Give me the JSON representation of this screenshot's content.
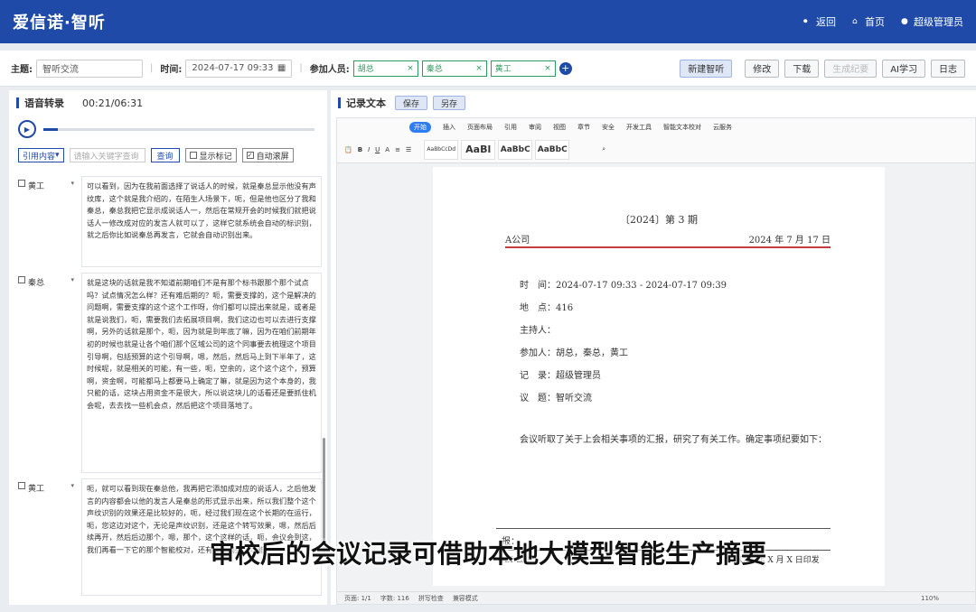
{
  "app": {
    "title": "爱信诺·智听"
  },
  "topnav": {
    "back": "返回",
    "home": "首页",
    "user": "超级管理员"
  },
  "meeting": {
    "topic_label": "主题:",
    "topic": "智听交流",
    "time_label": "时间:",
    "time": "2024-07-17 09:33",
    "participants_label": "参加人员:",
    "participants": [
      "胡总",
      "秦总",
      "黄工"
    ],
    "buttons": {
      "new": "新建智听",
      "edit": "修改",
      "download": "下载",
      "gen": "生成纪要",
      "ai": "AI学习",
      "log": "日志"
    }
  },
  "transcript": {
    "title": "语音转录",
    "time": "00:21/06:31",
    "progress": 0.054,
    "filter": "引用内容",
    "search_placeholder": "请输入关键字查询",
    "query": "查询",
    "show_mark": "显示标记",
    "auto_scroll": "自动滚屏",
    "entries": [
      {
        "speaker": "黄工",
        "text": "可以看到，因为在我前面选择了说话人的时候，就是秦总显示他没有声纹库，这个就是我介绍的，在陌生人场景下，呃，但是他也区分了我和秦总，秦总我把它显示成说话人一，然后在常规开会的时候我们就把说话人一修改成对应的发言人就可以了，这样它就系统会自动的标识别，就之后你比如说秦总再发言，它就会自动识别出来。"
      },
      {
        "speaker": "秦总",
        "text": "就是这块的话就是我不知道前期咱们不是有那个标书跟那个那个试点吗？试点情况怎么样？还有难后期的？呃，需要支撑的，这个是解决的问题啊，需要支撑的这个这个工作呀，你们都可以提出来就是，或者是就是说我们，呃，需要我们去拓展项目啊，我们这边也可以去进行支撑啊，另外的话就是那个，呃，因为就是到年底了嘛，因为在咱们前期年初的时候也就是让各个咱们那个区域公司的这个同事要去梳理这个项目引导啊，包括预算的这个引导啊，嗯，然后，然后马上到下半年了，这时候呢，就是相关的可能，有一些，呃，空余的，这个这个这个，预算啊，资金啊，可能都马上都要马上确定了嘛，就是因为这个本身的，我只能的话，这块占用资金不是很大，所以说这块儿的话看还是要抓住机会呢，去去找一些机会点，然后把这个项目落地了。"
      },
      {
        "speaker": "黄工",
        "text": "呃，就可以看到现在秦总他，我再把它添加成对应的说话人，之后他发言的内容都会以他的发言人是秦总的形式显示出来，所以我们整个这个声纹识别的效果还是比较好的，呃，经过我们现在这个长期的在运行，呃，您这边对这个，无论是声纹识别，还是这个转写效果，嗯，然后后续再开，然后后边那个，嗯，那个，这个这样的话，呃，会议会到这，我们再看一下它的那个智能校对，还有会议摘要的功能。"
      }
    ]
  },
  "record": {
    "title": "记录文本",
    "save": "保存",
    "save_as": "另存",
    "menus": [
      "开始",
      "插入",
      "页面布局",
      "引用",
      "审阅",
      "视图",
      "章节",
      "安全",
      "开发工具",
      "智能文本校对",
      "云服务"
    ],
    "styles": [
      "AaBbCcDd",
      "AaBl",
      "AaBbC",
      "AaBbC"
    ],
    "doc": {
      "issue": "〔2024〕第 3 期",
      "company": "A公司",
      "date": "2024 年 7 月 17 日",
      "time_line": "时　间：2024-07-17 09:33 - 2024-07-17 09:39",
      "place_line": "地　点：416",
      "host_line": "主持人：",
      "attendees_line": "参加人：胡总，秦总，黄工",
      "recorder_line": "记　录：超级管理员",
      "topic_line": "议　题：智听交流",
      "body": "会议听取了关于上会相关事项的汇报，研究了有关工作。确定事项纪要如下：",
      "footer_label": "报：",
      "footer_company": "XX 公司",
      "footer_date": "XXXX 年 X 月 X 日印发"
    },
    "status": {
      "page": "页面: 1/1",
      "words": "字数: 116",
      "spell": "拼写检查",
      "mode": "兼容模式",
      "zoom": "110%"
    }
  },
  "overlay": {
    "subtitle": "审校后的会议记录可借助本地大模型智能生产摘要"
  },
  "colors": {
    "brand": "#1f4aa8",
    "tag": "#2f9a5c",
    "redline": "#c63b3b"
  }
}
